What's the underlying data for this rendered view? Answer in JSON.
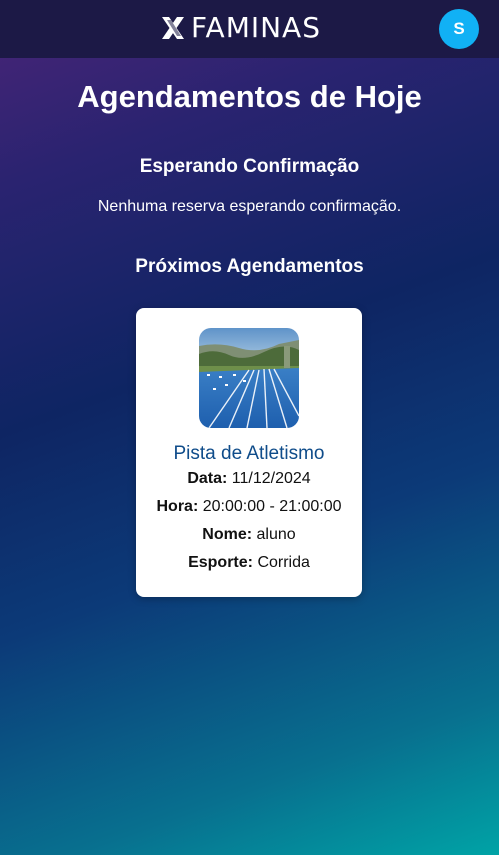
{
  "header": {
    "brand": "FAMINAS",
    "logo_icon": "x-mark-logo-icon",
    "avatar_initial": "S"
  },
  "main": {
    "title": "Agendamentos de Hoje",
    "pending": {
      "title": "Esperando Confirmação",
      "empty_message": "Nenhuma reserva esperando confirmação."
    },
    "upcoming": {
      "title": "Próximos Agendamentos",
      "cards": [
        {
          "image_icon": "running-track-image",
          "name": "Pista de Atletismo",
          "date_label": "Data:",
          "date_value": "11/12/2024",
          "time_label": "Hora:",
          "time_value": "20:00:00 - 21:00:00",
          "user_label": "Nome:",
          "user_value": "aluno",
          "sport_label": "Esporte:",
          "sport_value": "Corrida"
        }
      ]
    }
  },
  "colors": {
    "header_bg": "#1c1946",
    "avatar_bg": "#11b1f5",
    "card_title": "#0f4c8a",
    "gradient_start": "#4a2578",
    "gradient_end": "#00a3a6"
  }
}
